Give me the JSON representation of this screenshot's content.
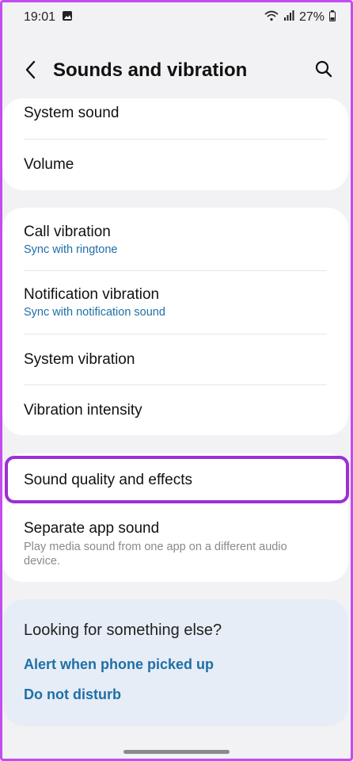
{
  "status_bar": {
    "time": "19:01",
    "battery": "27%",
    "icons": [
      "image-icon",
      "wifi-icon",
      "signal-icon",
      "battery-icon"
    ]
  },
  "app_bar": {
    "title": "Sounds and vibration",
    "back_icon": "back-arrow-icon",
    "search_icon": "search-icon"
  },
  "sections": {
    "sound": {
      "items": [
        {
          "title": "System sound"
        },
        {
          "title": "Volume"
        }
      ]
    },
    "vibration": {
      "items": [
        {
          "title": "Call vibration",
          "subtitle": "Sync with ringtone"
        },
        {
          "title": "Notification vibration",
          "subtitle": "Sync with notification sound"
        },
        {
          "title": "System vibration"
        },
        {
          "title": "Vibration intensity"
        }
      ]
    },
    "quality": {
      "items": [
        {
          "title": "Sound quality and effects"
        },
        {
          "title": "Separate app sound",
          "description": "Play media sound from one app on a different audio device."
        }
      ]
    }
  },
  "suggestions": {
    "title": "Looking for something else?",
    "links": [
      "Alert when phone picked up",
      "Do not disturb"
    ]
  },
  "colors": {
    "accent_link": "#1f6fa6",
    "highlight_border": "#9b2fd6",
    "frame_border": "#c44cf0",
    "background": "#f2f2f4"
  }
}
